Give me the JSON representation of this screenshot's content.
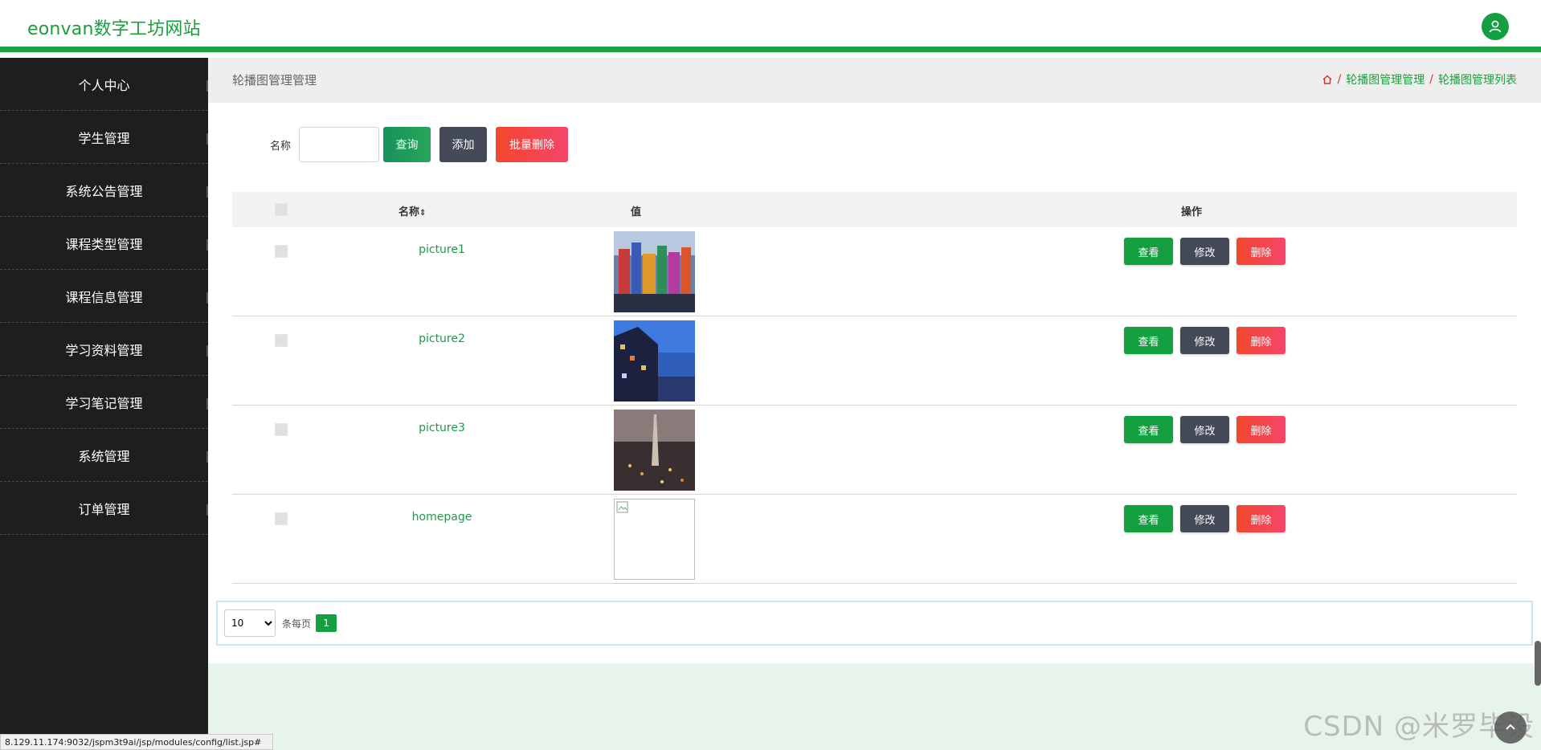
{
  "header": {
    "brand": "eonvan数字工坊网站"
  },
  "sidebar": {
    "items": [
      {
        "label": "个人中心"
      },
      {
        "label": "学生管理"
      },
      {
        "label": "系统公告管理"
      },
      {
        "label": "课程类型管理"
      },
      {
        "label": "课程信息管理"
      },
      {
        "label": "学习资料管理"
      },
      {
        "label": "学习笔记管理"
      },
      {
        "label": "系统管理"
      },
      {
        "label": "订单管理"
      }
    ]
  },
  "crumbbar": {
    "title": "轮播图管理管理",
    "breadcrumb": [
      "轮播图管理管理",
      "轮播图管理列表"
    ],
    "separator": "/"
  },
  "search": {
    "label": "名称",
    "value": "",
    "query_label": "查询",
    "add_label": "添加",
    "batch_delete_label": "批量删除"
  },
  "table": {
    "headers": {
      "name": "名称",
      "value": "值",
      "ops": "操作"
    },
    "rows": [
      {
        "name": "picture1",
        "image": "city-colorful"
      },
      {
        "name": "picture2",
        "image": "building-blue"
      },
      {
        "name": "picture3",
        "image": "city-night"
      },
      {
        "name": "homepage",
        "image": "broken"
      }
    ],
    "ops": {
      "view": "查看",
      "edit": "修改",
      "delete": "删除"
    }
  },
  "pager": {
    "per_page": "10",
    "per_page_options": [
      "10"
    ],
    "per_page_text": "条每页",
    "current_page": "1"
  },
  "status_url": "8.129.11.174:9032/jspm3t9ai/jsp/modules/config/list.jsp#",
  "watermark": "CSDN @米罗毕设",
  "colors": {
    "accent": "#1ea145",
    "sidebar_bg": "#1e1e1e",
    "danger": "#f2472c",
    "neutral": "#454a59"
  }
}
